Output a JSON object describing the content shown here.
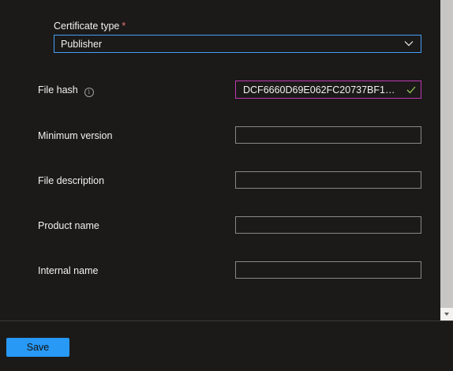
{
  "form": {
    "certificate_type": {
      "label": "Certificate type",
      "required_marker": "*",
      "selected_value": "Publisher"
    },
    "fields": [
      {
        "label": "File hash",
        "value": "DCF6660D69E062FC20737BF1D20...",
        "info": true,
        "valid": true
      },
      {
        "label": "Minimum version",
        "value": ""
      },
      {
        "label": "File description",
        "value": ""
      },
      {
        "label": "Product name",
        "value": ""
      },
      {
        "label": "Internal name",
        "value": ""
      }
    ]
  },
  "footer": {
    "save_label": "Save"
  },
  "icons": {
    "dropdown": "chevron-down-icon",
    "info": "info-icon",
    "valid": "checkmark-icon"
  },
  "colors": {
    "background": "#1b1a19",
    "accent": "#2899f5",
    "focus_border": "#479ef5",
    "valid_border": "#c239b3",
    "valid_check": "#92c353",
    "required": "#f1707b"
  }
}
